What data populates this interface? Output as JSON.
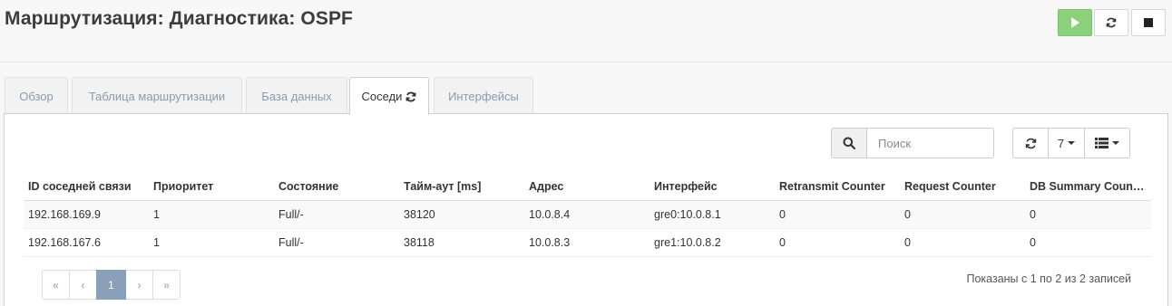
{
  "header": {
    "title": "Маршрутизация: Диагностика: OSPF"
  },
  "tabs": [
    {
      "label": "Обзор"
    },
    {
      "label": "Таблица маршрутизации"
    },
    {
      "label": "База данных"
    },
    {
      "label": "Соседи"
    },
    {
      "label": "Интерфейсы"
    }
  ],
  "search": {
    "placeholder": "Поиск",
    "value": ""
  },
  "toolbar": {
    "page_size": "7"
  },
  "table": {
    "columns": [
      "ID соседней связи",
      "Приоритет",
      "Состояние",
      "Тайм-аут [ms]",
      "Адрес",
      "Интерфейс",
      "Retransmit Counter",
      "Request Counter",
      "DB Summary Counter"
    ],
    "rows": [
      [
        "192.168.169.9",
        "1",
        "Full/-",
        "38120",
        "10.0.8.4",
        "gre0:10.0.8.1",
        "0",
        "0",
        "0"
      ],
      [
        "192.168.167.6",
        "1",
        "Full/-",
        "38118",
        "10.0.8.3",
        "gre1:10.0.8.2",
        "0",
        "0",
        "0"
      ]
    ]
  },
  "pagination": {
    "first": "«",
    "prev": "‹",
    "current": "1",
    "next": "›",
    "last": "»"
  },
  "info": "Показаны с 1 по 2 из 2 записей",
  "colors": {
    "play": "#8bd07a",
    "active_page": "#8a9fb9",
    "tab_inactive_text": "#8a9bab"
  },
  "icons": [
    "play-icon",
    "reload-icon",
    "stop-icon",
    "refresh-icon",
    "search-icon",
    "columns-icon"
  ]
}
